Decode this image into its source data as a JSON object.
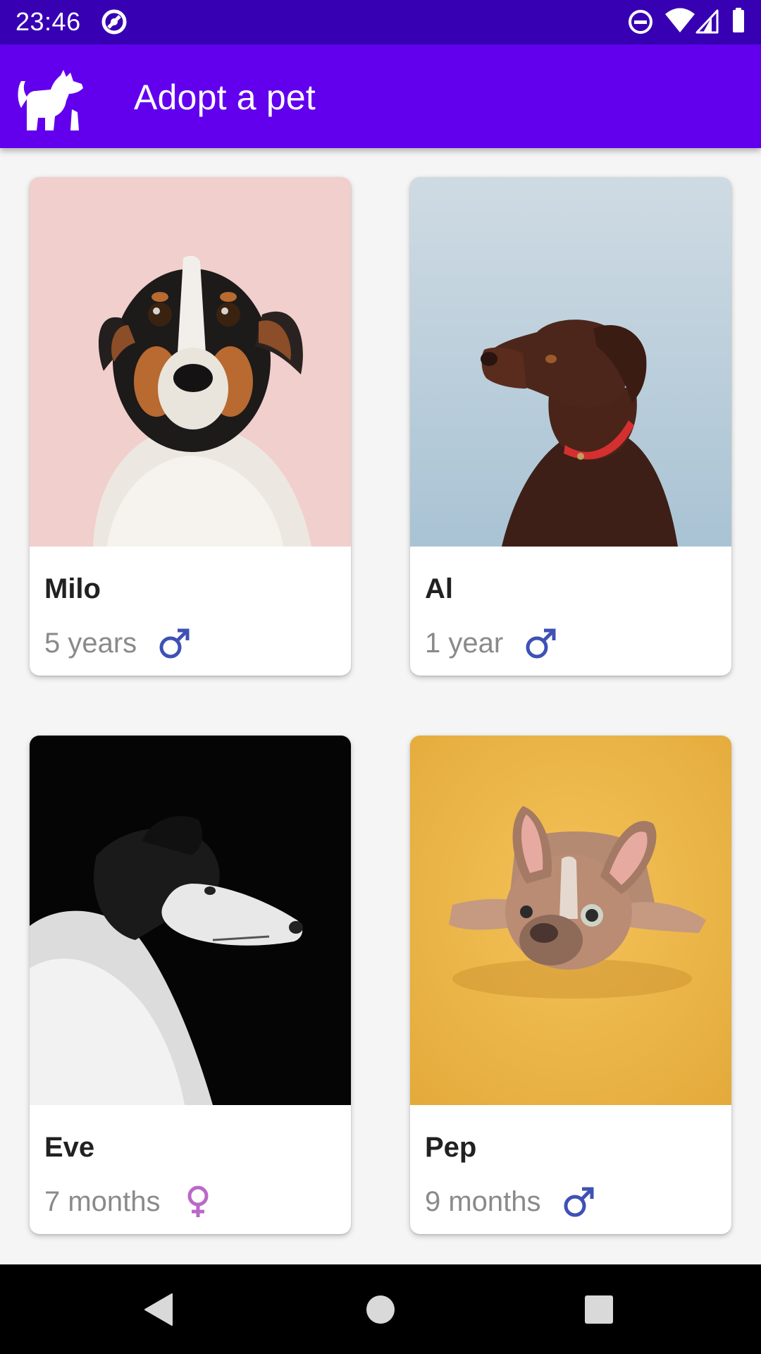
{
  "status_bar": {
    "time": "23:46",
    "left_icons": [
      "at-sign-icon"
    ],
    "right_icons": [
      "do-not-disturb-icon",
      "wifi-icon",
      "cell-signal-icon",
      "battery-icon"
    ]
  },
  "app_bar": {
    "title": "Adopt a pet",
    "logo_icon": "dog-icon",
    "background_color": "#6200ee"
  },
  "colors": {
    "status_bar": "#3700b3",
    "app_bar": "#6200ee",
    "male_icon": "#3f51b5",
    "female_icon": "#ba68c8",
    "age_text": "#8a8a8a",
    "name_text": "#212121"
  },
  "pets": [
    {
      "name": "Milo",
      "age": "5 years",
      "gender": "male",
      "gender_icon": "male-symbol-icon",
      "photo": "terrier dog on pink background"
    },
    {
      "name": "Al",
      "age": "1 year",
      "gender": "male",
      "gender_icon": "male-symbol-icon",
      "photo": "chocolate labrador on blue background"
    },
    {
      "name": "Eve",
      "age": "7 months",
      "gender": "female",
      "gender_icon": "female-symbol-icon",
      "photo": "black and white dog in profile on black background"
    },
    {
      "name": "Pep",
      "age": "9 months",
      "gender": "male",
      "gender_icon": "male-symbol-icon",
      "photo": "french bulldog lying on yellow background"
    }
  ],
  "nav_bar": {
    "buttons": [
      "back-icon",
      "home-icon",
      "recents-icon"
    ]
  }
}
